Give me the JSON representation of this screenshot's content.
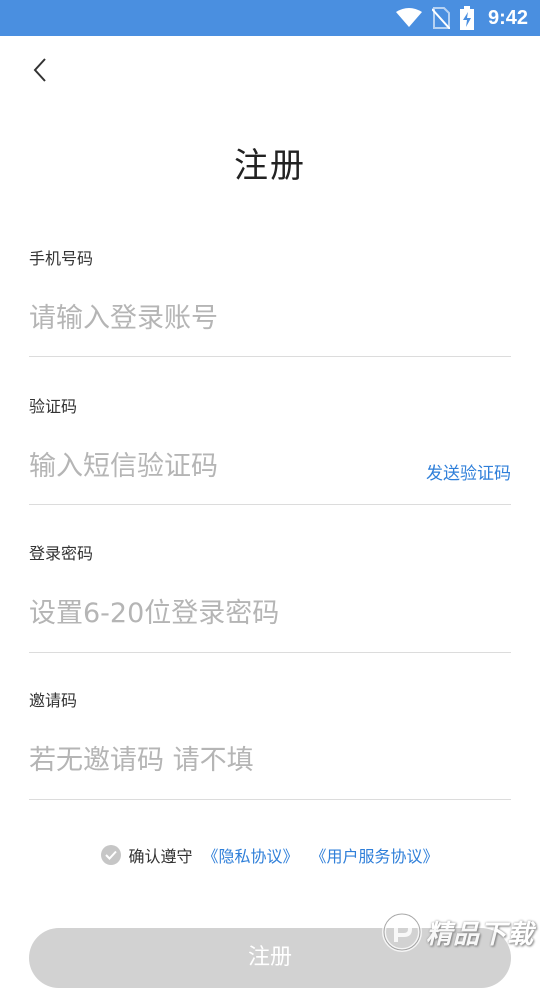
{
  "status_bar": {
    "time": "9:42"
  },
  "header": {
    "title": "注册"
  },
  "fields": {
    "phone": {
      "label": "手机号码",
      "placeholder": "请输入登录账号"
    },
    "code": {
      "label": "验证码",
      "placeholder": "输入短信验证码",
      "action": "发送验证码"
    },
    "password": {
      "label": "登录密码",
      "placeholder": "设置6-20位登录密码"
    },
    "invite": {
      "label": "邀请码",
      "placeholder": "若无邀请码 请不填"
    }
  },
  "agreement": {
    "text": "确认遵守",
    "privacy_link": "《隐私协议》",
    "service_link": "《用户服务协议》",
    "checked": false
  },
  "submit": {
    "label": "注册"
  },
  "watermark": {
    "text": "精品下载"
  },
  "colors": {
    "status_bar": "#4a8fe0",
    "link": "#2f7fd9",
    "button_disabled": "#d2d2d2"
  }
}
